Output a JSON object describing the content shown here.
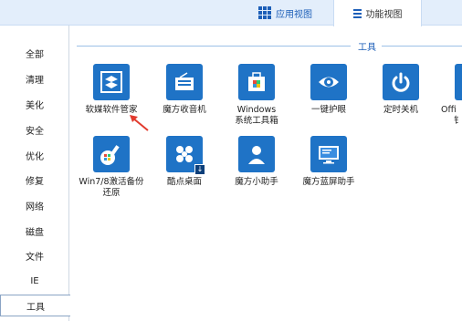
{
  "tabs": {
    "apps": "应用视图",
    "functions": "功能视图"
  },
  "sidebar": {
    "items": [
      {
        "label": "全部"
      },
      {
        "label": "清理"
      },
      {
        "label": "美化"
      },
      {
        "label": "安全"
      },
      {
        "label": "优化"
      },
      {
        "label": "修复"
      },
      {
        "label": "网络"
      },
      {
        "label": "磁盘"
      },
      {
        "label": "文件"
      },
      {
        "label": "IE"
      },
      {
        "label": "工具",
        "active": true
      }
    ]
  },
  "section": {
    "title": "工具"
  },
  "tools": [
    {
      "label": "软媒软件管家",
      "icon": "software-manager-icon"
    },
    {
      "label": "魔方收音机",
      "icon": "radio-icon"
    },
    {
      "label": "Windows",
      "label2": "系统工具箱",
      "icon": "windows-toolbox-icon"
    },
    {
      "label": "一键护眼",
      "icon": "eye-icon"
    },
    {
      "label": "定时关机",
      "icon": "power-icon"
    },
    {
      "label": "Offi",
      "label2": "钅",
      "icon": "office-icon"
    },
    {
      "label": "Win7/8激活备份",
      "label2": "还原",
      "icon": "activation-key-icon"
    },
    {
      "label": "酷点桌面",
      "icon": "desktop-tool-icon"
    },
    {
      "label": "魔方小助手",
      "icon": "assistant-icon"
    },
    {
      "label": "魔方蓝屏助手",
      "icon": "bluescreen-icon"
    }
  ],
  "colors": {
    "accent": "#1f73c6",
    "tabbar": "#e3eefb",
    "arrow": "#e23b2e"
  }
}
